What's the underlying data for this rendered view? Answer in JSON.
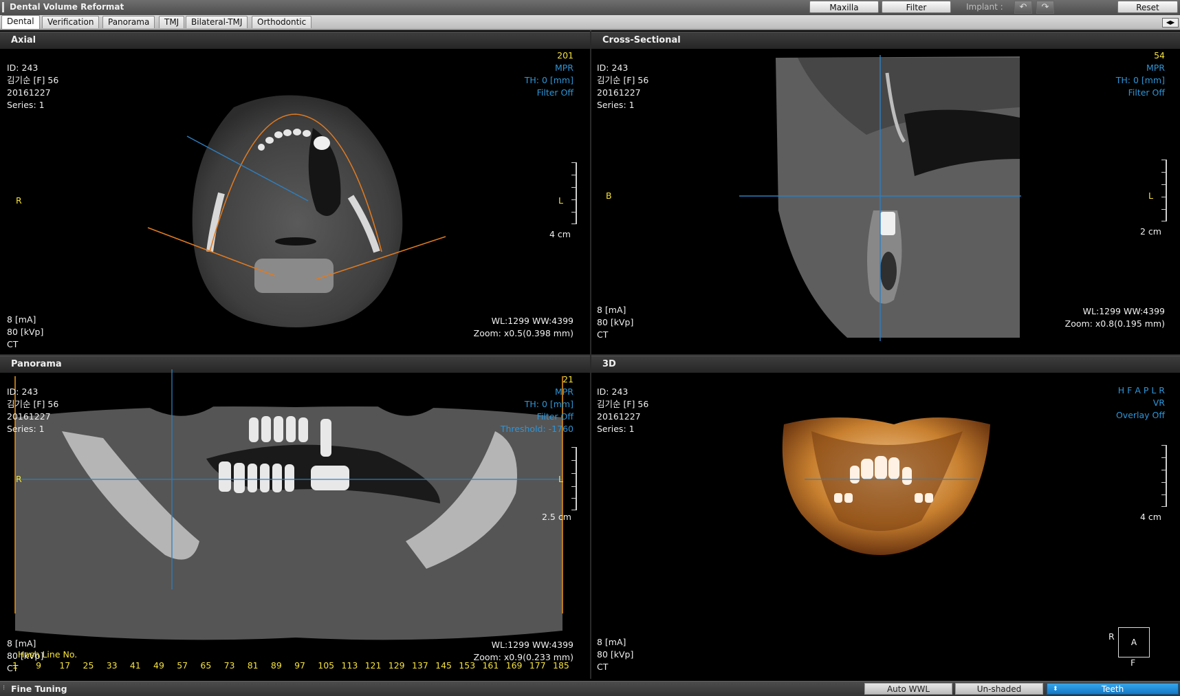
{
  "titlebar": {
    "title": "Dental Volume Reformat",
    "buttons": {
      "maxilla": "Maxilla",
      "filter": "Filter",
      "reset": "Reset"
    },
    "implant_label": "Implant :"
  },
  "tabs": [
    "Dental",
    "Verification",
    "Panorama",
    "TMJ",
    "Bilateral-TMJ",
    "Orthodontic"
  ],
  "panels": {
    "axial": {
      "title": "Axial",
      "info": [
        "ID: 243",
        "김기순 [F] 56",
        "20161227",
        "Series: 1"
      ],
      "right_top": {
        "slice": "201",
        "mode": "MPR",
        "th": "TH: 0 [mm]",
        "filter": "Filter Off"
      },
      "left_marker": "R",
      "right_marker": "L",
      "scale": "4 cm",
      "acq": [
        "8 [mA]",
        "80 [kVp]",
        "CT"
      ],
      "wl": "WL:1299 WW:4399",
      "zoom": "Zoom: x0.5(0.398 mm)"
    },
    "cross": {
      "title": "Cross-Sectional",
      "info": [
        "ID: 243",
        "김기순 [F] 56",
        "20161227",
        "Series: 1"
      ],
      "right_top": {
        "slice": "54",
        "mode": "MPR",
        "th": "TH: 0 [mm]",
        "filter": "Filter Off"
      },
      "left_marker": "B",
      "right_marker": "L",
      "scale": "2 cm",
      "acq": [
        "8 [mA]",
        "80 [kVp]",
        "CT"
      ],
      "wl": "WL:1299 WW:4399",
      "zoom": "Zoom: x0.8(0.195 mm)"
    },
    "panorama": {
      "title": "Panorama",
      "info": [
        "ID: 243",
        "김기순 [F] 56",
        "20161227",
        "Series: 1"
      ],
      "right_top": {
        "slice": "21",
        "mode": "MPR",
        "th": "TH: 0 [mm]",
        "filter": "Filter Off",
        "threshold": "Threshold: -1760"
      },
      "left_marker": "R",
      "right_marker": "L",
      "scale": "2.5 cm",
      "acq": [
        "8 [mA]",
        "80 [kVp]",
        "CT"
      ],
      "hash_label": "Hash Line No.",
      "hash_numbers": [
        "1",
        "9",
        "17",
        "25",
        "33",
        "41",
        "49",
        "57",
        "65",
        "73",
        "81",
        "89",
        "97",
        "105",
        "113",
        "121",
        "129",
        "137",
        "145",
        "153",
        "161",
        "169",
        "177",
        "185"
      ],
      "wl": "WL:1299 WW:4399",
      "zoom": "Zoom: x0.9(0.233 mm)"
    },
    "vr": {
      "title": "3D",
      "info": [
        "ID: 243",
        "김기순 [F] 56",
        "20161227",
        "Series: 1"
      ],
      "right_top": {
        "orient": "H F A P L R",
        "mode": "VR",
        "overlay": "Overlay Off"
      },
      "scale": "4 cm",
      "acq": [
        "8 [mA]",
        "80 [kVp]",
        "CT"
      ],
      "orient_box": {
        "center": "A",
        "left": "R",
        "bottom": "F"
      }
    }
  },
  "statusbar": {
    "title": "Fine Tuning",
    "auto_wwl": "Auto WWL",
    "unshaded": "Un-shaded",
    "teeth": "Teeth"
  }
}
